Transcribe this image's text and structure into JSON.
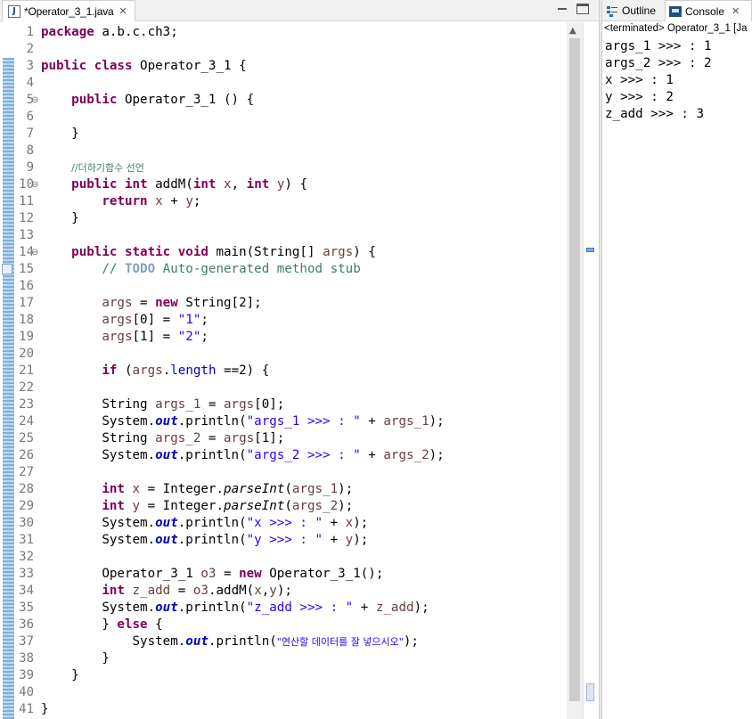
{
  "editor": {
    "tab_label": "*Operator_3_1.java",
    "file_icon": "java-file-icon",
    "lines": [
      [
        {
          "t": "package",
          "c": "kw"
        },
        {
          "t": " a.b.c.ch3;"
        }
      ],
      [],
      [
        {
          "t": "public",
          "c": "kw"
        },
        {
          "t": " "
        },
        {
          "t": "class",
          "c": "kw"
        },
        {
          "t": " Operator_3_1 {"
        }
      ],
      [],
      [
        {
          "t": "    "
        },
        {
          "t": "public",
          "c": "kw"
        },
        {
          "t": " Operator_3_1 () {"
        }
      ],
      [],
      [
        {
          "t": "    }"
        }
      ],
      [],
      [
        {
          "t": "    "
        },
        {
          "t": "//더하기함수 선언",
          "c": "cm ko"
        }
      ],
      [
        {
          "t": "    "
        },
        {
          "t": "public",
          "c": "kw"
        },
        {
          "t": " "
        },
        {
          "t": "int",
          "c": "kw"
        },
        {
          "t": " addM("
        },
        {
          "t": "int",
          "c": "kw"
        },
        {
          "t": " "
        },
        {
          "t": "x",
          "c": "var"
        },
        {
          "t": ", "
        },
        {
          "t": "int",
          "c": "kw"
        },
        {
          "t": " "
        },
        {
          "t": "y",
          "c": "var"
        },
        {
          "t": ") {"
        }
      ],
      [
        {
          "t": "        "
        },
        {
          "t": "return",
          "c": "kw"
        },
        {
          "t": " "
        },
        {
          "t": "x",
          "c": "var"
        },
        {
          "t": " + "
        },
        {
          "t": "y",
          "c": "var"
        },
        {
          "t": ";"
        }
      ],
      [
        {
          "t": "    }"
        }
      ],
      [],
      [
        {
          "t": "    "
        },
        {
          "t": "public",
          "c": "kw"
        },
        {
          "t": " "
        },
        {
          "t": "static",
          "c": "kw"
        },
        {
          "t": " "
        },
        {
          "t": "void",
          "c": "kw"
        },
        {
          "t": " main(String[] "
        },
        {
          "t": "args",
          "c": "var"
        },
        {
          "t": ") {"
        }
      ],
      [
        {
          "t": "        "
        },
        {
          "t": "// ",
          "c": "cm"
        },
        {
          "t": "TODO",
          "c": "todo"
        },
        {
          "t": " Auto-generated method stub",
          "c": "cm"
        }
      ],
      [],
      [
        {
          "t": "        "
        },
        {
          "t": "args",
          "c": "var"
        },
        {
          "t": " = "
        },
        {
          "t": "new",
          "c": "kw"
        },
        {
          "t": " String[2];"
        }
      ],
      [
        {
          "t": "        "
        },
        {
          "t": "args",
          "c": "var"
        },
        {
          "t": "[0] = "
        },
        {
          "t": "\"1\"",
          "c": "str"
        },
        {
          "t": ";"
        }
      ],
      [
        {
          "t": "        "
        },
        {
          "t": "args",
          "c": "var"
        },
        {
          "t": "[1] = "
        },
        {
          "t": "\"2\"",
          "c": "str"
        },
        {
          "t": ";"
        }
      ],
      [],
      [
        {
          "t": "        "
        },
        {
          "t": "if",
          "c": "kw"
        },
        {
          "t": " ("
        },
        {
          "t": "args",
          "c": "var"
        },
        {
          "t": "."
        },
        {
          "t": "length",
          "c": "fld"
        },
        {
          "t": " ==2) {"
        }
      ],
      [],
      [
        {
          "t": "        String "
        },
        {
          "t": "args_1",
          "c": "var"
        },
        {
          "t": " = "
        },
        {
          "t": "args",
          "c": "var"
        },
        {
          "t": "[0];"
        }
      ],
      [
        {
          "t": "        System."
        },
        {
          "t": "out",
          "c": "sfld"
        },
        {
          "t": ".println("
        },
        {
          "t": "\"args_1 >>> : \"",
          "c": "str"
        },
        {
          "t": " + "
        },
        {
          "t": "args_1",
          "c": "var"
        },
        {
          "t": ");"
        }
      ],
      [
        {
          "t": "        String "
        },
        {
          "t": "args_2",
          "c": "var"
        },
        {
          "t": " = "
        },
        {
          "t": "args",
          "c": "var"
        },
        {
          "t": "[1];"
        }
      ],
      [
        {
          "t": "        System."
        },
        {
          "t": "out",
          "c": "sfld"
        },
        {
          "t": ".println("
        },
        {
          "t": "\"args_2 >>> : \"",
          "c": "str"
        },
        {
          "t": " + "
        },
        {
          "t": "args_2",
          "c": "var"
        },
        {
          "t": ");"
        }
      ],
      [],
      [
        {
          "t": "        "
        },
        {
          "t": "int",
          "c": "kw"
        },
        {
          "t": " "
        },
        {
          "t": "x",
          "c": "var"
        },
        {
          "t": " = Integer."
        },
        {
          "t": "parseInt",
          "c": "sm"
        },
        {
          "t": "("
        },
        {
          "t": "args_1",
          "c": "var"
        },
        {
          "t": ");"
        }
      ],
      [
        {
          "t": "        "
        },
        {
          "t": "int",
          "c": "kw"
        },
        {
          "t": " "
        },
        {
          "t": "y",
          "c": "var"
        },
        {
          "t": " = Integer."
        },
        {
          "t": "parseInt",
          "c": "sm"
        },
        {
          "t": "("
        },
        {
          "t": "args_2",
          "c": "var"
        },
        {
          "t": ");"
        }
      ],
      [
        {
          "t": "        System."
        },
        {
          "t": "out",
          "c": "sfld"
        },
        {
          "t": ".println("
        },
        {
          "t": "\"x >>> : \"",
          "c": "str"
        },
        {
          "t": " + "
        },
        {
          "t": "x",
          "c": "var"
        },
        {
          "t": ");"
        }
      ],
      [
        {
          "t": "        System."
        },
        {
          "t": "out",
          "c": "sfld"
        },
        {
          "t": ".println("
        },
        {
          "t": "\"y >>> : \"",
          "c": "str"
        },
        {
          "t": " + "
        },
        {
          "t": "y",
          "c": "var"
        },
        {
          "t": ");"
        }
      ],
      [],
      [
        {
          "t": "        Operator_3_1 "
        },
        {
          "t": "o3",
          "c": "var"
        },
        {
          "t": " = "
        },
        {
          "t": "new",
          "c": "kw"
        },
        {
          "t": " Operator_3_1();"
        }
      ],
      [
        {
          "t": "        "
        },
        {
          "t": "int",
          "c": "kw"
        },
        {
          "t": " "
        },
        {
          "t": "z_add",
          "c": "var"
        },
        {
          "t": " = "
        },
        {
          "t": "o3",
          "c": "var"
        },
        {
          "t": ".addM("
        },
        {
          "t": "x",
          "c": "var"
        },
        {
          "t": ","
        },
        {
          "t": "y",
          "c": "var"
        },
        {
          "t": ");"
        }
      ],
      [
        {
          "t": "        System."
        },
        {
          "t": "out",
          "c": "sfld"
        },
        {
          "t": ".println("
        },
        {
          "t": "\"z_add >>> : \"",
          "c": "str"
        },
        {
          "t": " + "
        },
        {
          "t": "z_add",
          "c": "var"
        },
        {
          "t": ");"
        }
      ],
      [
        {
          "t": "        } "
        },
        {
          "t": "else",
          "c": "kw"
        },
        {
          "t": " {"
        }
      ],
      [
        {
          "t": "            System."
        },
        {
          "t": "out",
          "c": "sfld"
        },
        {
          "t": ".println("
        },
        {
          "t": "\"연산할 데이터를 잘 넣으시오\"",
          "c": "str ko"
        },
        {
          "t": ");"
        }
      ],
      [
        {
          "t": "        }"
        }
      ],
      [
        {
          "t": "    }"
        }
      ],
      [],
      [
        {
          "t": "}"
        }
      ]
    ],
    "fold_lines": [
      5,
      10,
      14
    ],
    "task_marker_line": 15
  },
  "console": {
    "outline_label": "Outline",
    "console_label": "Console",
    "header": "<terminated> Operator_3_1 [Ja",
    "output": [
      "args_1 >>> : 1",
      "args_2 >>> : 2",
      "x >>> : 1",
      "y >>> : 2",
      "z_add >>> : 3"
    ]
  }
}
